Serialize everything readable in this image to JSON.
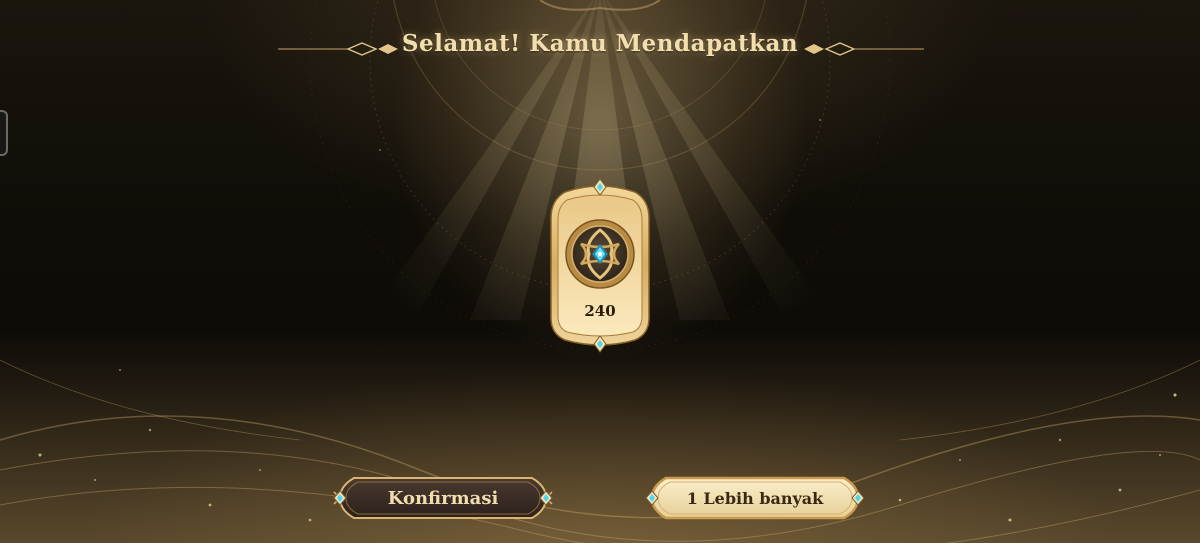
{
  "dialog": {
    "title": "Selamat! Kamu Mendapatkan"
  },
  "reward": {
    "icon": "diamond-emblem-icon",
    "amount": "240"
  },
  "buttons": {
    "confirm_label": "Konfirmasi",
    "more_label": "1 Lebih banyak"
  },
  "colors": {
    "title_gold": "#f3dfae",
    "accent_gem": "#4fd6e8",
    "dark_button": "#3a2a22",
    "light_button": "#f1e0b3"
  }
}
